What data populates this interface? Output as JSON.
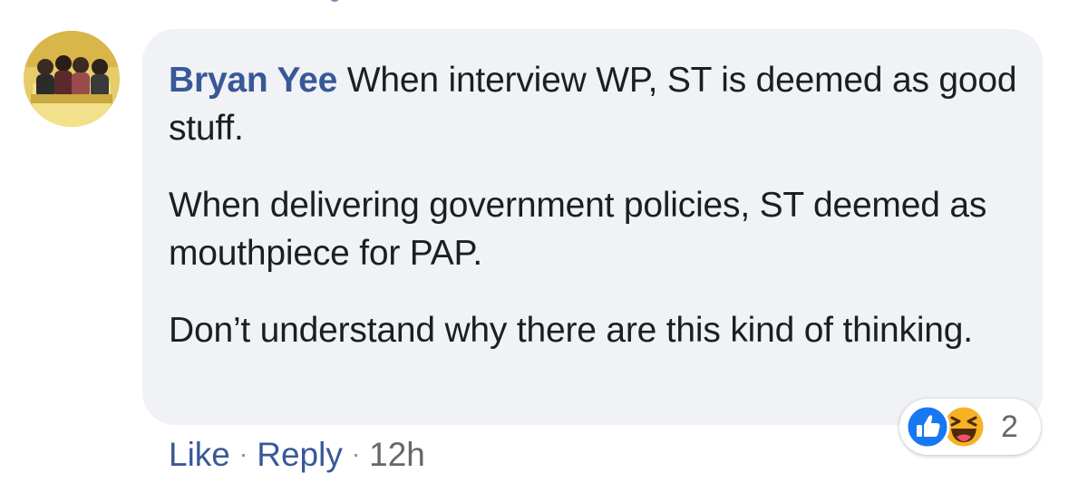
{
  "comment": {
    "author": "Bryan Yee",
    "paragraphs": [
      "When interview WP, ST is deemed as good stuff.",
      "When delivering government policies, ST deemed as mouthpiece for PAP.",
      "Don’t understand why there are this kind of thinking."
    ]
  },
  "actions": {
    "like_label": "Like",
    "reply_label": "Reply",
    "separator": "·",
    "timestamp": "12h"
  },
  "reactions": {
    "types": [
      "like-icon",
      "haha-icon"
    ],
    "count": "2"
  },
  "colors": {
    "bubble_bg": "#f0f2f5",
    "author_link": "#385898",
    "like_blue": "#1877f2",
    "haha_yellow": "#f7b125"
  }
}
